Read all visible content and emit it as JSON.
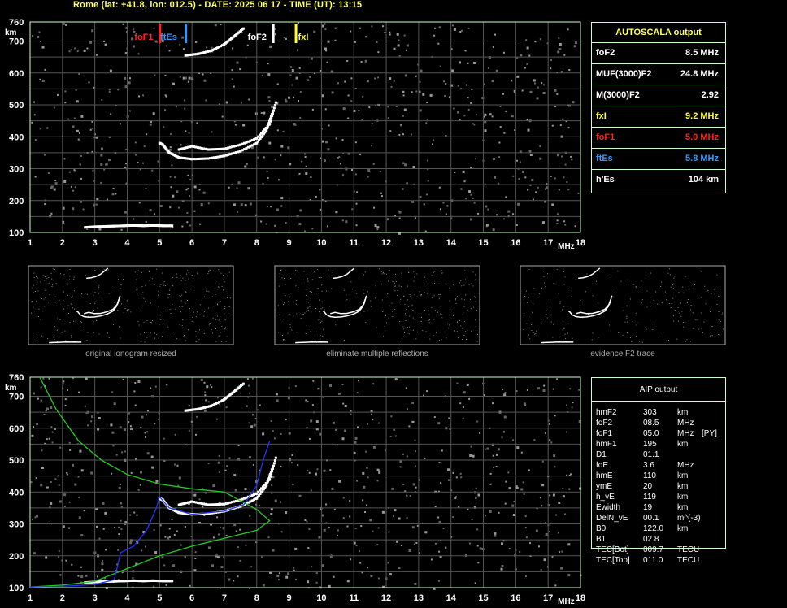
{
  "header": {
    "text": "Rome (lat: +41.8, lon: 012.5) - DATE: 2025 06 17 - TIME (UT): 13:15"
  },
  "axes": {
    "y_unit": "km",
    "x_unit": "MHz",
    "y_ticks": [
      "100",
      "200",
      "300",
      "400",
      "500",
      "600",
      "700",
      "760"
    ],
    "x_ticks": [
      "1",
      "2",
      "3",
      "4",
      "5",
      "6",
      "7",
      "8",
      "9",
      "10",
      "11",
      "12",
      "13",
      "14",
      "15",
      "16",
      "17",
      "18"
    ]
  },
  "markers": [
    {
      "label": "foF1",
      "freq": 5.0,
      "color": "#ff2222"
    },
    {
      "label": "ftEs",
      "freq": 5.8,
      "color": "#3399ff"
    },
    {
      "label": "foF2",
      "freq": 8.5,
      "color": "#ffffff"
    },
    {
      "label": "fxI",
      "freq": 9.2,
      "color": "#ffff33"
    }
  ],
  "autoscala": {
    "title": "AUTOSCALA output",
    "rows": [
      {
        "key": "foF2",
        "val": "8.5 MHz",
        "kc": "#ffffff",
        "vc": "#ffffff"
      },
      {
        "key": "MUF(3000)F2",
        "val": "24.8 MHz",
        "kc": "#ffffff",
        "vc": "#ffffff"
      },
      {
        "key": "M(3000)F2",
        "val": "2.92",
        "kc": "#ffffff",
        "vc": "#ffffff"
      },
      {
        "key": "fxI",
        "val": "9.2 MHz",
        "kc": "#ffff33",
        "vc": "#ffff33"
      },
      {
        "key": "foF1",
        "val": "5.0 MHz",
        "kc": "#ff2222",
        "vc": "#ff2222"
      },
      {
        "key": "ftEs",
        "val": "5.8 MHz",
        "kc": "#3399ff",
        "vc": "#3399ff"
      },
      {
        "key": "h'Es",
        "val": "104   km",
        "kc": "#ffffff",
        "vc": "#ffffff"
      }
    ]
  },
  "thumbnails": [
    {
      "caption": "original ionogram resized"
    },
    {
      "caption": "eliminate multiple reflections"
    },
    {
      "caption": "evidence F2 trace"
    }
  ],
  "aip": {
    "title": "AIP output",
    "rows": [
      {
        "k": "hmF2",
        "v": "303",
        "u": "km",
        "x": ""
      },
      {
        "k": "foF2",
        "v": "08.5",
        "u": "MHz",
        "x": ""
      },
      {
        "k": "foF1",
        "v": "05.0",
        "u": "MHz",
        "x": "[PY]"
      },
      {
        "k": "hmF1",
        "v": "195",
        "u": "km",
        "x": ""
      },
      {
        "k": "D1",
        "v": "01.1",
        "u": "",
        "x": ""
      },
      {
        "k": "foE",
        "v": "3.6",
        "u": "MHz",
        "x": ""
      },
      {
        "k": "hmE",
        "v": "110",
        "u": "km",
        "x": ""
      },
      {
        "k": "ymE",
        "v": "20",
        "u": "km",
        "x": ""
      },
      {
        "k": "h_vE",
        "v": "119",
        "u": "km",
        "x": ""
      },
      {
        "k": "Ewidth",
        "v": "19",
        "u": "km",
        "x": ""
      },
      {
        "k": "DelN_vE",
        "v": "00.1",
        "u": "m^(-3)",
        "x": ""
      },
      {
        "k": "B0",
        "v": "122.0",
        "u": "km",
        "x": ""
      },
      {
        "k": "B1",
        "v": "02.8",
        "u": "",
        "x": ""
      },
      {
        "k": "TEC[Bot]",
        "v": "009.7",
        "u": "TECU",
        "x": ""
      },
      {
        "k": "TEC[Top]",
        "v": "011.0",
        "u": "TECU",
        "x": ""
      }
    ]
  },
  "chart_data": [
    {
      "type": "scatter",
      "xlim": [
        1,
        18
      ],
      "ylim": [
        100,
        760
      ],
      "grid": true,
      "series": [
        {
          "color": "#ffffff",
          "x": [
            2.7,
            3.0,
            3.3,
            3.6,
            3.9,
            4.2,
            4.5,
            4.8,
            5.1,
            5.4
          ],
          "y": [
            116,
            118,
            119,
            120,
            121,
            122,
            121,
            122,
            121,
            121
          ]
        },
        {
          "color": "#ffffff",
          "x": [
            5.0,
            5.1,
            5.3,
            5.6,
            6.0,
            6.5,
            7.0,
            7.5,
            8.0,
            8.3,
            8.5
          ],
          "y": [
            380,
            375,
            350,
            335,
            330,
            332,
            340,
            355,
            380,
            420,
            480
          ]
        },
        {
          "color": "#ffffff",
          "x": [
            5.6,
            6.0,
            6.5,
            7.0,
            7.5,
            8.0,
            8.4,
            8.6
          ],
          "y": [
            360,
            370,
            360,
            362,
            375,
            395,
            440,
            510
          ]
        },
        {
          "color": "#ffffff",
          "x": [
            5.8,
            6.2,
            6.6,
            7.0,
            7.3,
            7.6
          ],
          "y": [
            655,
            660,
            670,
            690,
            715,
            740
          ]
        }
      ]
    },
    {
      "type": "line",
      "xlim": [
        1,
        18
      ],
      "ylim": [
        100,
        760
      ],
      "grid": true,
      "series": [
        {
          "color": "#22cc22",
          "x": [
            1.3,
            1.8,
            2.5,
            3.2,
            4.0,
            5.0,
            6.0,
            7.0,
            8.0,
            8.4,
            8.0,
            7.0,
            6.0,
            5.0,
            4.0,
            3.5,
            3.0,
            2.0,
            1.0
          ],
          "y": [
            760,
            660,
            560,
            500,
            455,
            425,
            410,
            400,
            345,
            310,
            280,
            255,
            230,
            200,
            160,
            140,
            120,
            108,
            102
          ]
        },
        {
          "color": "#2233ff",
          "x": [
            1.0,
            2.0,
            3.0,
            3.6,
            3.8,
            4.2,
            4.6,
            4.9,
            5.0,
            5.3,
            6.0,
            7.0,
            7.6,
            8.0,
            8.2,
            8.4
          ],
          "y": [
            102,
            104,
            110,
            125,
            210,
            230,
            280,
            350,
            385,
            350,
            330,
            340,
            360,
            420,
            500,
            560
          ]
        }
      ]
    }
  ]
}
